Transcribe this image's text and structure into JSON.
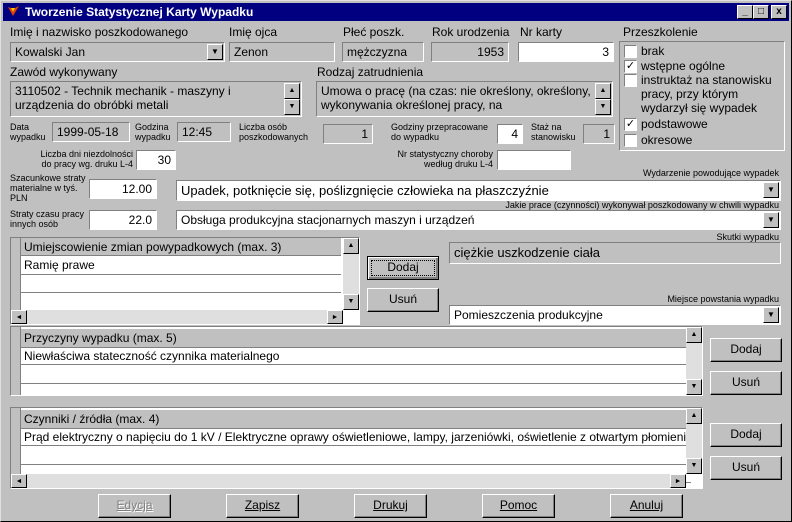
{
  "window": {
    "title": "Tworzenie Statystycznej Karty Wypadku",
    "minimize_glyph": "_",
    "maximize_glyph": "□",
    "close_glyph": "x"
  },
  "icons": {
    "app_icon": "app-logo-icon",
    "dropdown": "chevron-down-icon",
    "scroll_up": "arrow-up-icon",
    "scroll_down": "arrow-down-icon"
  },
  "header_labels": {
    "name": "Imię i nazwisko poszkodowanego",
    "father": "Imię ojca",
    "sex": "Płeć poszk.",
    "birth_year": "Rok urodzenia",
    "card_no": "Nr karty",
    "training": "Przeszkolenie"
  },
  "fields": {
    "name": "Kowalski Jan",
    "father": "Zenon",
    "sex": "mężczyzna",
    "birth_year": "1953",
    "card_no": "3"
  },
  "training": {
    "options": [
      {
        "label": "brak",
        "checked": false
      },
      {
        "label": "wstępne ogólne",
        "checked": true
      },
      {
        "label": "instruktaż na stanowisku pracy, przy którym wydarzył się wypadek",
        "checked": false
      },
      {
        "label": "podstawowe",
        "checked": true
      },
      {
        "label": "okresowe",
        "checked": false
      }
    ],
    "line1": "instruktaż na stanowisku",
    "line2": "pracy, przy którym",
    "line3": "wydarzył się wypadek"
  },
  "occupation": {
    "label": "Zawód wykonywany",
    "value": "3110502 - Technik mechanik - maszyny i urządzenia do obróbki metali"
  },
  "employment": {
    "label": "Rodzaj zatrudnienia",
    "value": "Umowa o pracę (na czas: nie określony, określony, wykonywania określonej pracy, na"
  },
  "row3": {
    "date_label": "Data wypadku",
    "date_value": "1999-05-18",
    "hour_label": "Godzina wypadku",
    "hour_value": "12:45",
    "persons_label": "Liczba osób poszkodowanych",
    "persons_value": "1",
    "hours_worked_label": "Godziny przepracowane do wypadku",
    "hours_worked_value": "4",
    "seniority_label": "Staż na stanowisku",
    "seniority_value": "1"
  },
  "row4": {
    "days_label": "Liczba dni niezdolności do pracy wg. druku L-4",
    "days_value": "30",
    "disease_label": "Nr statystyczny choroby według druku L-4",
    "disease_value": ""
  },
  "losses": {
    "material_label": "Szacunkowe straty materialne w tyś. PLN",
    "material_value": "12.00",
    "time_label": "Straty czasu pracy innych osób",
    "time_value": "22.0"
  },
  "event": {
    "label": "Wydarzenie powodujące wypadek",
    "value": "Upadek, potknięcie się, poślizgnięcie człowieka na płaszczyźnie"
  },
  "work": {
    "label": "Jakie prace (czynności) wykonywał poszkodowany w chwili wypadku",
    "value": "Obsługa produkcyjna stacjonarnych maszyn i urządzeń"
  },
  "injury_grid": {
    "header": "Umiejscowienie zmian powypadkowych (max. 3)",
    "rows": [
      "Ramię prawe",
      "",
      ""
    ]
  },
  "effects": {
    "label": "Skutki wypadku",
    "value": "ciężkie uszkodzenie ciała"
  },
  "place": {
    "label": "Miejsce powstania wypadku",
    "value": "Pomieszczenia produkcyjne"
  },
  "causes_grid": {
    "header": "Przyczyny wypadku (max. 5)",
    "rows": [
      "Niewłaściwa stateczność czynnika materialnego",
      "",
      ""
    ]
  },
  "factors_grid": {
    "header": "Czynniki / źródła (max. 4)",
    "rows": [
      "Prąd elektryczny o napięciu do 1 kV / Elektryczne oprawy oświetleniowe, lampy, jarzeniówki, oświetlenie z otwartym płomieniem",
      "",
      ""
    ]
  },
  "buttons": {
    "add": "Dodaj",
    "remove": "Usuń",
    "edit": "Edycja",
    "save": "Zapisz",
    "print": "Drukuj",
    "help": "Pomoc",
    "cancel": "Anuluj"
  }
}
